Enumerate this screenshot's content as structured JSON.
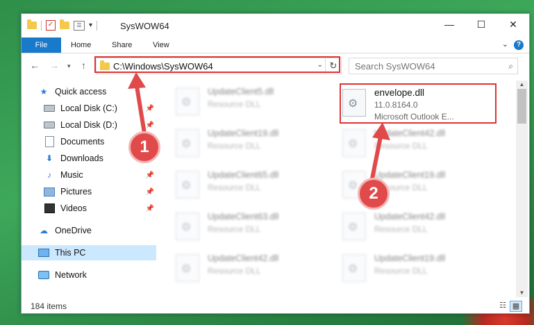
{
  "window": {
    "title": "SysWOW64",
    "controls": {
      "minimize": "—",
      "maximize": "☐",
      "close": "✕"
    }
  },
  "ribbon": {
    "tabs": [
      "File",
      "Home",
      "Share",
      "View"
    ],
    "help": "?"
  },
  "address": {
    "path": "C:\\Windows\\SysWOW64",
    "search_placeholder": "Search SysWOW64"
  },
  "sidebar": {
    "items": [
      {
        "label": "Quick access",
        "icon": "star-icon"
      },
      {
        "label": "Local Disk (C:)",
        "icon": "drive-icon"
      },
      {
        "label": "Local Disk (D:)",
        "icon": "drive-icon"
      },
      {
        "label": "Documents",
        "icon": "documents-icon"
      },
      {
        "label": "Downloads",
        "icon": "downloads-icon"
      },
      {
        "label": "Music",
        "icon": "music-icon"
      },
      {
        "label": "Pictures",
        "icon": "pictures-icon"
      },
      {
        "label": "Videos",
        "icon": "videos-icon"
      },
      {
        "label": "OneDrive",
        "icon": "cloud-icon"
      },
      {
        "label": "This PC",
        "icon": "computer-icon"
      },
      {
        "label": "Network",
        "icon": "network-icon"
      }
    ]
  },
  "files": {
    "left": [
      {
        "name": "UpdateClient5.dll",
        "desc": "Resource DLL"
      },
      {
        "name": "UpdateClient19.dll",
        "desc": "Resource DLL"
      },
      {
        "name": "UpdateClient65.dll",
        "desc": "Resource DLL"
      },
      {
        "name": "UpdateClient63.dll",
        "desc": "Resource DLL"
      },
      {
        "name": "UpdateClient42.dll",
        "desc": "Resource DLL"
      }
    ],
    "selected": {
      "name": "envelope.dll",
      "version": "11.0.8164.0",
      "desc": "Microsoft Outlook E..."
    },
    "right": [
      {
        "name": "UpdateClient42.dll",
        "desc": "Resource DLL"
      },
      {
        "name": "UpdateClient19.dll",
        "desc": "Resource DLL"
      },
      {
        "name": "UpdateClient42.dll",
        "desc": "Resource DLL"
      },
      {
        "name": "UpdateClient19.dll",
        "desc": "Resource DLL"
      }
    ]
  },
  "status": {
    "count": "184 items"
  },
  "callouts": {
    "one": "1",
    "two": "2"
  },
  "colors": {
    "accent": "#1979ca",
    "highlight": "#dd3333",
    "selection": "#cce8ff"
  }
}
